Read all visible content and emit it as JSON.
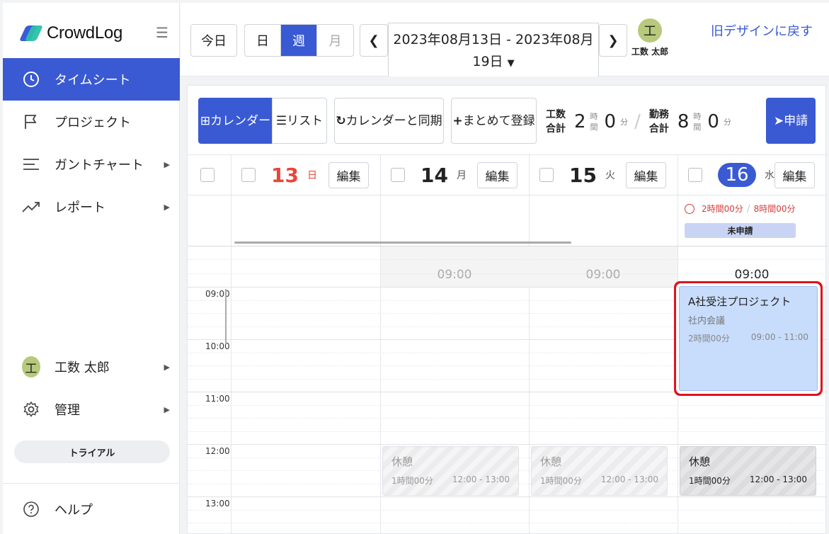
{
  "brand": {
    "name": "CrowdLog"
  },
  "sidebar": {
    "items": [
      {
        "label": "タイムシート",
        "icon": "clock-icon"
      },
      {
        "label": "プロジェクト",
        "icon": "flag-icon"
      },
      {
        "label": "ガントチャート",
        "icon": "gantt-icon"
      },
      {
        "label": "レポート",
        "icon": "trend-icon"
      }
    ],
    "user": {
      "initial": "工",
      "name": "工数 太郎"
    },
    "admin": {
      "label": "管理"
    },
    "trial": "トライアル",
    "help": {
      "label": "ヘルプ"
    }
  },
  "topbar": {
    "today": "今日",
    "views": [
      "日",
      "週",
      "月"
    ],
    "active_view": "週",
    "range": "2023年08月13日 - 2023年08月19日",
    "user_initial": "工",
    "user_name": "工数 太郎",
    "old_design": "旧デザインに戻す"
  },
  "toolbar": {
    "calendar": "カレンダー",
    "list": "リスト",
    "sync": "カレンダーと同期",
    "bulk": "まとめて登録",
    "kosu_label": "工数合計",
    "kosu_hours": "2",
    "kosu_minutes": "0",
    "kinmu_label": "勤務合計",
    "kinmu_hours": "8",
    "kinmu_minutes": "0",
    "unit_hour": "時間",
    "unit_min": "分",
    "apply": "申請"
  },
  "days": [
    {
      "num": "13",
      "weekday": "日",
      "color": "#e8453c"
    },
    {
      "num": "14",
      "weekday": "月",
      "color": "#111111"
    },
    {
      "num": "15",
      "weekday": "火",
      "color": "#111111"
    },
    {
      "num": "16",
      "weekday": "水",
      "color": "#ffffff"
    }
  ],
  "edit_label": "編集",
  "day16_summary": {
    "worked": "2時間00分",
    "required": "8時間00分",
    "status": "未申請"
  },
  "allday_times": [
    "09:00",
    "09:00",
    "09:00"
  ],
  "time_labels": [
    "09:00",
    "10:00",
    "11:00",
    "12:00",
    "13:00"
  ],
  "events": {
    "project": {
      "title": "A社受注プロジェクト",
      "sub": "社内会議",
      "duration": "2時間00分",
      "range": "09:00 - 11:00"
    },
    "break": {
      "title": "休憩",
      "duration": "1時間00分",
      "range": "12:00 - 13:00"
    }
  }
}
